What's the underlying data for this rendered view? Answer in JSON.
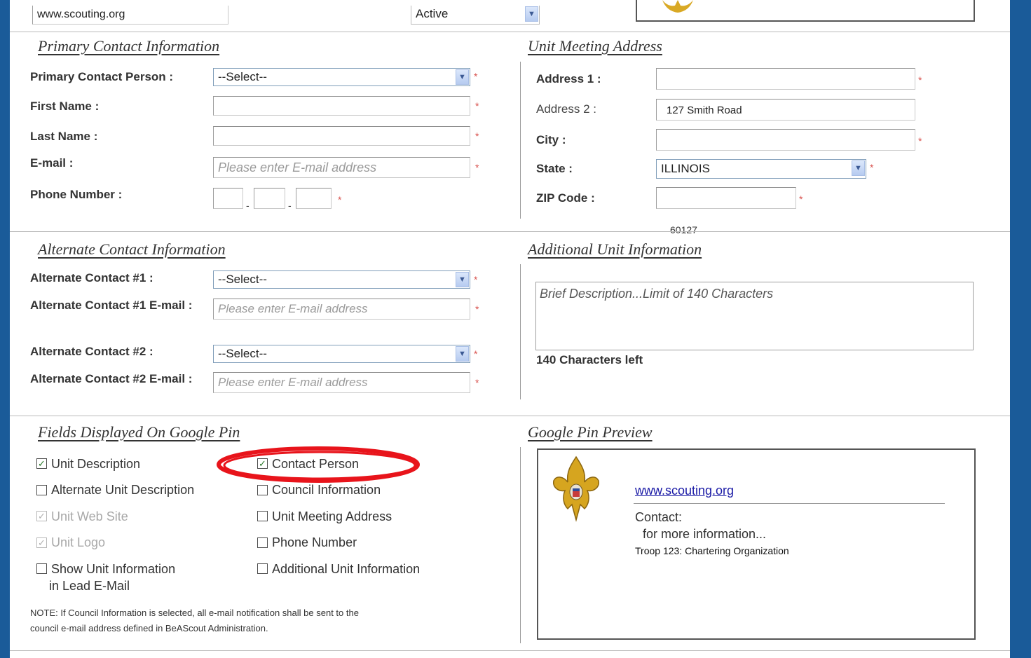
{
  "top": {
    "website_value": "www.scouting.org",
    "status_value": "Active"
  },
  "primary": {
    "title": "Primary Contact Information",
    "person_label": "Primary Contact Person :",
    "person_value": "--Select--",
    "first_label": "First Name :",
    "first_value": "",
    "last_label": "Last Name :",
    "last_value": "",
    "email_label": "E-mail :",
    "email_placeholder": "Please enter E-mail address",
    "phone_label": "Phone Number :",
    "phone_sep": "-",
    "required_mark": "*"
  },
  "meeting": {
    "title": "Unit Meeting Address",
    "address1_label": "Address 1 :",
    "address1_value": "",
    "address2_label": "Address 2 :",
    "address2_value": "127 Smith Road",
    "city_label": "City :",
    "city_value": "",
    "state_label": "State :",
    "state_value": "ILLINOIS",
    "zip_label": "ZIP Code :",
    "zip_value": "",
    "zip_overflow": "60127"
  },
  "alternate": {
    "title": "Alternate Contact Information",
    "c1_label": "Alternate Contact #1 :",
    "c1_value": "--Select--",
    "c1_email_label": "Alternate Contact #1 E-mail :",
    "c1_email_placeholder": "Please enter E-mail address",
    "c2_label": "Alternate Contact #2 :",
    "c2_value": "--Select--",
    "c2_email_label": "Alternate Contact #2 E-mail :",
    "c2_email_placeholder": "Please enter E-mail address"
  },
  "additional": {
    "title": "Additional Unit Information",
    "description_placeholder": "Brief Description...Limit of 140 Characters",
    "chars_left": "140 Characters left"
  },
  "pin_fields": {
    "title": "Fields Displayed On Google Pin",
    "unit_description": "Unit Description",
    "alternate_unit_description": "Alternate Unit Description",
    "unit_web_site": "Unit Web Site",
    "unit_logo": "Unit Logo",
    "show_unit_info_line1": "Show Unit Information",
    "show_unit_info_line2": "in Lead E-Mail",
    "contact_person": "Contact Person",
    "council_information": "Council Information",
    "unit_meeting_address": "Unit Meeting Address",
    "phone_number": "Phone Number",
    "additional_unit_information": "Additional Unit Information",
    "note_line1": "NOTE: If Council Information is selected, all e-mail notification shall be sent to the",
    "note_line2": "council e-mail address defined in BeAScout Administration.",
    "check_mark": "✓"
  },
  "preview": {
    "title": "Google Pin Preview",
    "link": "www.scouting.org",
    "contact_label": "Contact:",
    "more_info": "for more information...",
    "troop_line": "Troop 123: Chartering Organization"
  },
  "colors": {
    "frame_blue": "#1a5b99",
    "required_red": "#d9534f",
    "highlight_red": "#e8141b",
    "link_blue": "#1a1aa6"
  }
}
